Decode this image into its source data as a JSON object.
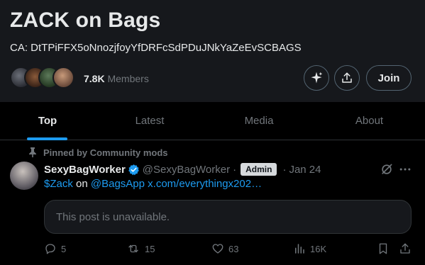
{
  "community": {
    "title": "ZACK on Bags",
    "ca_text": "CA: DtTPiFFX5oNnozjfoyYfDRFcSdPDuJNkYaZeEvSCBAGS",
    "member_count": "7.8K",
    "member_label": "Members",
    "join_label": "Join"
  },
  "tabs": [
    {
      "label": "Top",
      "active": true
    },
    {
      "label": "Latest",
      "active": false
    },
    {
      "label": "Media",
      "active": false
    },
    {
      "label": "About",
      "active": false
    }
  ],
  "post": {
    "pinned_label": "Pinned by Community mods",
    "display_name": "SexyBagWorker",
    "handle": "@SexyBagWorker",
    "separator": "·",
    "badge": "Admin",
    "date": "Jan 24",
    "text_link1": "$Zack",
    "text_on": "on",
    "text_link2": "@BagsApp",
    "text_link3": "x.com/everythingx202…",
    "unavailable_text": "This post is unavailable.",
    "stats": {
      "replies": "5",
      "reposts": "15",
      "likes": "63",
      "views": "16K"
    }
  },
  "colors": {
    "accent": "#1d9bf0",
    "background": "#000000",
    "header_bg": "#16181c",
    "muted_text": "#71767b"
  },
  "icons": {
    "spark": "grok-sparkle-icon",
    "share": "share-upload-icon",
    "pin": "pin-icon",
    "verified": "verified-badge-icon",
    "grok": "grok-icon",
    "more": "more-dots-icon",
    "reply": "reply-icon",
    "repost": "repost-icon",
    "like": "heart-icon",
    "views": "views-chart-icon",
    "bookmark": "bookmark-icon"
  }
}
